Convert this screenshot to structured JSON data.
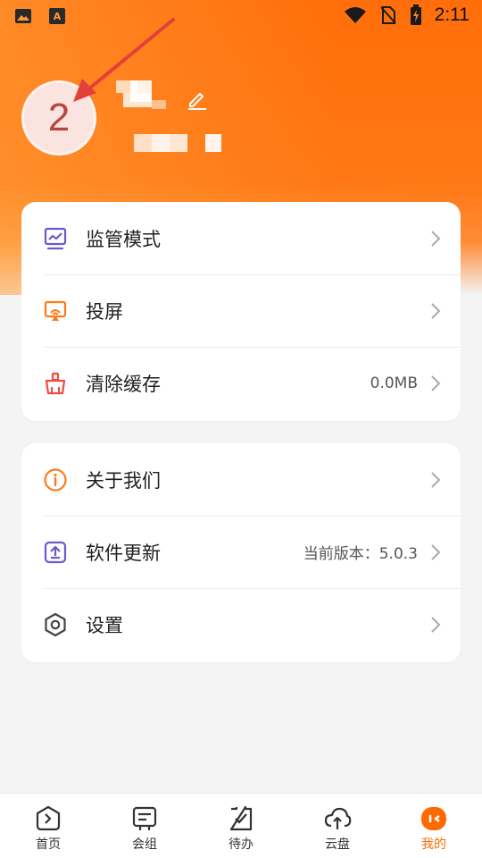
{
  "status_bar": {
    "time": "2:11",
    "left_icons": [
      "image-icon",
      "a-badge-icon"
    ],
    "right_icons": [
      "wifi-icon",
      "no-sim-icon",
      "battery-charging-icon"
    ]
  },
  "profile": {
    "avatar_text": "2",
    "edit_icon": "pencil-icon"
  },
  "colors": {
    "accent": "#ff6a00",
    "icon_purple": "#6a5acd",
    "icon_orange": "#ff7a1a",
    "icon_red": "#ee4b3e"
  },
  "menu_group_1": [
    {
      "icon": "monitor-chart-icon",
      "label": "监管模式",
      "value": ""
    },
    {
      "icon": "cast-screen-icon",
      "label": "投屏",
      "value": ""
    },
    {
      "icon": "broom-icon",
      "label": "清除缓存",
      "value": "0.0MB"
    }
  ],
  "menu_group_2": [
    {
      "icon": "info-icon",
      "label": "关于我们",
      "value": ""
    },
    {
      "icon": "upload-icon",
      "label": "软件更新",
      "value": "当前版本：5.0.3"
    },
    {
      "icon": "hexagon-settings-icon",
      "label": "设置",
      "value": ""
    }
  ],
  "tabbar": [
    {
      "icon": "home-chevron-icon",
      "label": "首页",
      "active": false
    },
    {
      "icon": "meeting-icon",
      "label": "会组",
      "active": false
    },
    {
      "icon": "todo-check-icon",
      "label": "待办",
      "active": false
    },
    {
      "icon": "cloud-upload-icon",
      "label": "云盘",
      "active": false
    },
    {
      "icon": "profile-face-icon",
      "label": "我的",
      "active": true
    }
  ]
}
